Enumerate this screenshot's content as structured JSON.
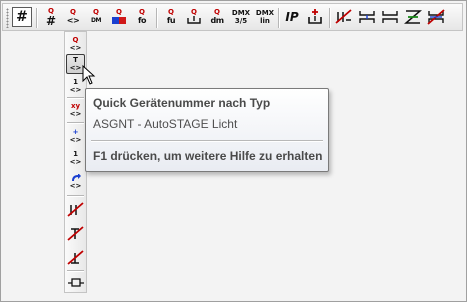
{
  "toolbar": {
    "buttons": [
      {
        "name": "hash-button",
        "top": "",
        "bottom": "#"
      },
      {
        "name": "hash-q-button",
        "top": "Q",
        "bottom": "#"
      },
      {
        "name": "q-swap-button",
        "top": "Q",
        "bottom": "<>"
      },
      {
        "name": "dm-q-button",
        "top": "Q",
        "bottom": "DM"
      },
      {
        "name": "color-q-button",
        "top": "Q",
        "bottom": ""
      },
      {
        "name": "fo-q-button",
        "top": "Q",
        "bottom": "fo"
      },
      {
        "name": "fu-q-button",
        "top": "Q",
        "bottom": "fu"
      },
      {
        "name": "pos-q-button",
        "top": "Q",
        "bottom": ""
      },
      {
        "name": "dm-q2-button",
        "top": "Q",
        "bottom": "dm"
      },
      {
        "name": "dmx-35-button",
        "top": "DMX",
        "bottom": "3/5"
      },
      {
        "name": "dmx-lin-button",
        "top": "DMX",
        "bottom": "lin"
      },
      {
        "name": "ip-button",
        "top": "",
        "bottom": "IP"
      },
      {
        "name": "add-device-button",
        "top": "",
        "bottom": ""
      },
      {
        "name": "no-link-button",
        "top": "",
        "bottom": ""
      },
      {
        "name": "bracket-button",
        "top": "",
        "bottom": ""
      },
      {
        "name": "split-button",
        "top": "",
        "bottom": ""
      },
      {
        "name": "convert-button",
        "top": "",
        "bottom": ""
      },
      {
        "name": "clear-links-button",
        "top": "",
        "bottom": ""
      }
    ]
  },
  "vertical_toolbar": {
    "items": [
      {
        "top": "Q",
        "bottom": "<>"
      },
      {
        "top": "T",
        "bottom": "<>"
      },
      {
        "top": "1",
        "bottom": "<>"
      },
      {
        "top": "xy",
        "bottom": "<>"
      },
      {
        "top": "+",
        "bottom": "<>"
      },
      {
        "top": "1",
        "bottom": "<>"
      },
      {
        "top": "",
        "bottom": "<>"
      }
    ]
  },
  "tooltip": {
    "title": "Quick Gerätenummer nach Typ",
    "description": "ASGNT - AutoSTAGE Licht",
    "help": "F1 drücken, um weitere Hilfe zu erhalten"
  },
  "colors": {
    "accent_red": "#c00000",
    "tooltip_border": "#7a7a7a"
  }
}
